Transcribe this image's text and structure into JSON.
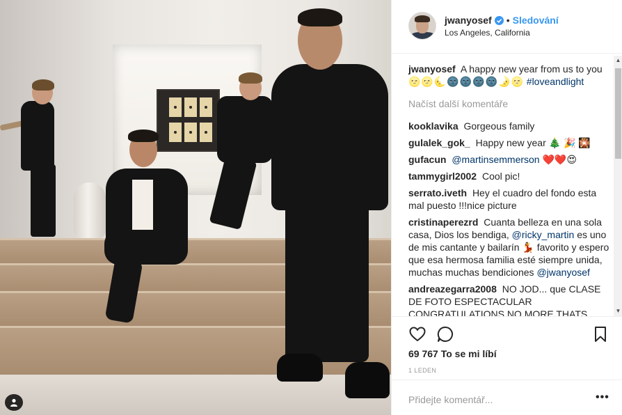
{
  "header": {
    "username": "jwanyosef",
    "separator": "•",
    "follow_label": "Sledování",
    "location": "Los Angeles, California"
  },
  "caption": {
    "username": "jwanyosef",
    "text": "A happy new year from us to you",
    "emojis": "🌝🌝🌜🌚🌚🌚🌚🌛🌝",
    "hashtag": "#loveandlight"
  },
  "load_more_label": "Načíst další komentáře",
  "comments": [
    {
      "user": "kooklavika",
      "text": "Gorgeous family"
    },
    {
      "user": "gulalek_gok_",
      "text": "Happy new year 🎄 🎉 🎇"
    },
    {
      "user": "gufacun",
      "mention": "@martinsemmerson",
      "text": "❤️❤️😍"
    },
    {
      "user": "tammygirl2002",
      "text": "Cool pic!"
    },
    {
      "user": "serrato.iveth",
      "text": "Hey el cuadro del fondo esta mal puesto !!!nice picture"
    },
    {
      "user": "cristinaperezrd",
      "text_a": "Cuanta belleza en una sola casa, Dios los bendiga,",
      "mention_a": "@ricky_martin",
      "text_b": "es uno de mis cantante y bailarín 💃 favorito y espero que esa hermosa familia esté siempre unida, muchas muchas bendiciones",
      "mention_b": "@jwanyosef"
    },
    {
      "user": "andreazegarra2008",
      "text": "NO JOD... que CLASE DE FOTO ESPECTACULAR CONGRATULATIONS NO MORE THATS FOR"
    }
  ],
  "scrollbar": {
    "up_arrow": "▲",
    "down_arrow": "▼"
  },
  "likes": {
    "count": "69 767",
    "label": "To se mi líbí"
  },
  "date": "1 LEDEN",
  "add_comment": {
    "placeholder": "Přidejte komentář..."
  },
  "more_label": "•••",
  "colors": {
    "accent": "#3897f0",
    "mention": "#003569",
    "muted": "#999999"
  }
}
